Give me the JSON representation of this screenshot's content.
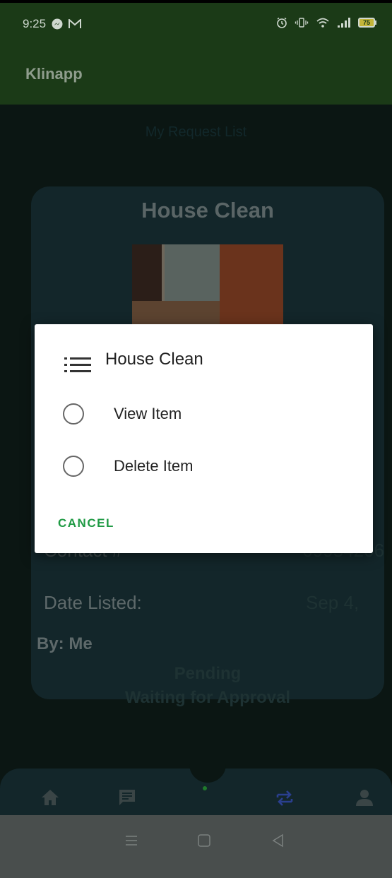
{
  "status_bar": {
    "time": "9:25",
    "battery": "75"
  },
  "app": {
    "title": "Klinapp"
  },
  "page": {
    "heading": "My Request List"
  },
  "card": {
    "title": "House Clean",
    "contact_label": "Contact #",
    "contact_value": "09954206",
    "date_label": "Date Listed:",
    "date_value": "Sep 4,",
    "by": "By: Me",
    "status": "Pending",
    "status_detail": "Waiting for Approval"
  },
  "dialog": {
    "title": "House Clean",
    "options": [
      {
        "label": "View Item"
      },
      {
        "label": "Delete Item"
      }
    ],
    "cancel_label": "CANCEL"
  },
  "bottom_nav": {
    "items": [
      {
        "icon": "home-icon"
      },
      {
        "icon": "chat-icon"
      },
      {
        "icon": "swap-icon",
        "active": true
      },
      {
        "icon": "person-icon"
      }
    ]
  },
  "colors": {
    "app_bar": "#1b3a17",
    "accent": "#1f9a44",
    "active_nav": "#2a3f8f"
  }
}
